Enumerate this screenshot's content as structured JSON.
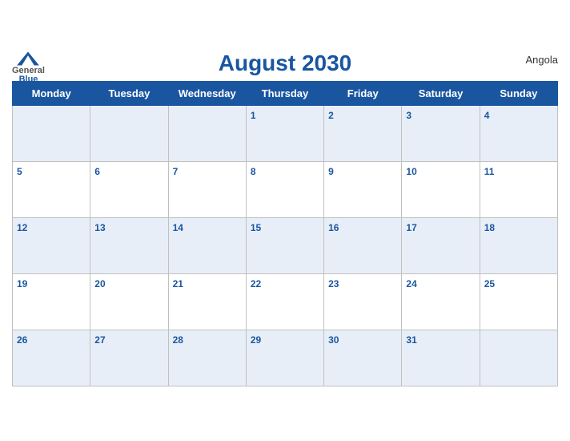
{
  "header": {
    "title": "August 2030",
    "country": "Angola",
    "logo_general": "General",
    "logo_blue": "Blue"
  },
  "weekdays": [
    "Monday",
    "Tuesday",
    "Wednesday",
    "Thursday",
    "Friday",
    "Saturday",
    "Sunday"
  ],
  "weeks": [
    [
      {
        "day": "",
        "empty": true
      },
      {
        "day": "",
        "empty": true
      },
      {
        "day": "",
        "empty": true
      },
      {
        "day": "1",
        "empty": false
      },
      {
        "day": "2",
        "empty": false
      },
      {
        "day": "3",
        "empty": false
      },
      {
        "day": "4",
        "empty": false
      }
    ],
    [
      {
        "day": "5",
        "empty": false
      },
      {
        "day": "6",
        "empty": false
      },
      {
        "day": "7",
        "empty": false
      },
      {
        "day": "8",
        "empty": false
      },
      {
        "day": "9",
        "empty": false
      },
      {
        "day": "10",
        "empty": false
      },
      {
        "day": "11",
        "empty": false
      }
    ],
    [
      {
        "day": "12",
        "empty": false
      },
      {
        "day": "13",
        "empty": false
      },
      {
        "day": "14",
        "empty": false
      },
      {
        "day": "15",
        "empty": false
      },
      {
        "day": "16",
        "empty": false
      },
      {
        "day": "17",
        "empty": false
      },
      {
        "day": "18",
        "empty": false
      }
    ],
    [
      {
        "day": "19",
        "empty": false
      },
      {
        "day": "20",
        "empty": false
      },
      {
        "day": "21",
        "empty": false
      },
      {
        "day": "22",
        "empty": false
      },
      {
        "day": "23",
        "empty": false
      },
      {
        "day": "24",
        "empty": false
      },
      {
        "day": "25",
        "empty": false
      }
    ],
    [
      {
        "day": "26",
        "empty": false
      },
      {
        "day": "27",
        "empty": false
      },
      {
        "day": "28",
        "empty": false
      },
      {
        "day": "29",
        "empty": false
      },
      {
        "day": "30",
        "empty": false
      },
      {
        "day": "31",
        "empty": false
      },
      {
        "day": "",
        "empty": true
      }
    ]
  ]
}
